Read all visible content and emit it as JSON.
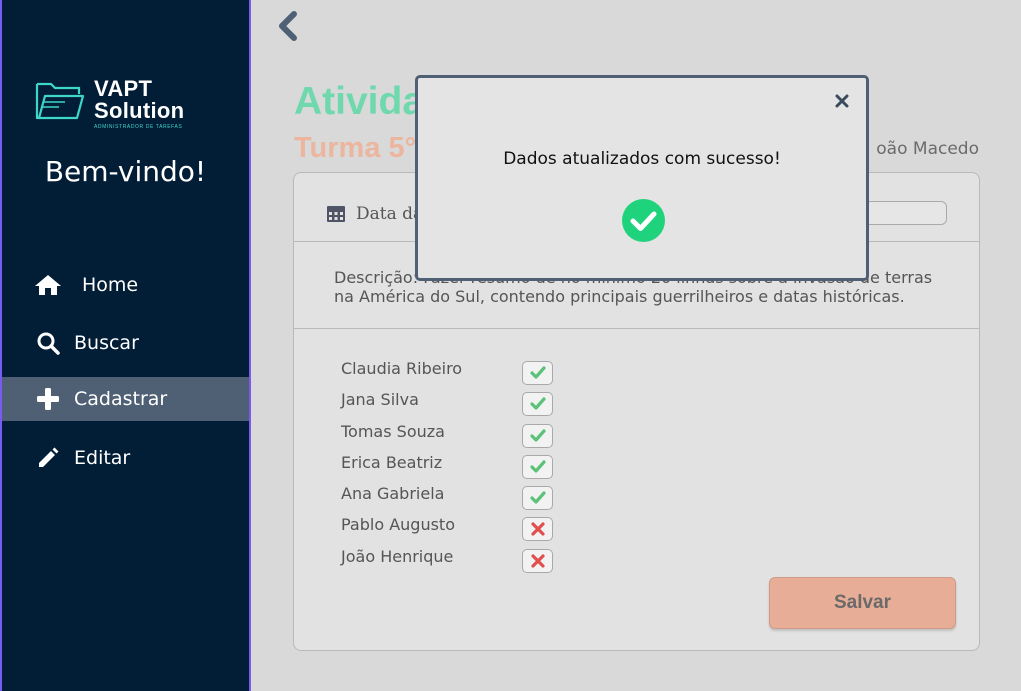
{
  "sidebar": {
    "logo": {
      "line1": "VAPT",
      "line2": "Solution",
      "tagline": "ADMINISTRADOR DE TAREFAS"
    },
    "welcome": "Bem-vindo!",
    "nav": [
      {
        "label": "Home",
        "icon": "home-icon"
      },
      {
        "label": "Buscar",
        "icon": "search-icon"
      },
      {
        "label": "Cadastrar",
        "icon": "plus-icon",
        "active": true
      },
      {
        "label": "Editar",
        "icon": "pencil-icon"
      }
    ]
  },
  "main": {
    "title": "Ativida",
    "subtitle": "Turma 5°",
    "teacher": "oão Macedo",
    "date_label": "Data da",
    "description": "Descrição: Fazer resumo de no mínimo 20 linhas sobre a invasão de terras na América do Sul, contendo principais guerrilheiros e datas históricas.",
    "students": [
      {
        "name": "Claudia Ribeiro",
        "present": true
      },
      {
        "name": "Jana Silva",
        "present": true
      },
      {
        "name": "Tomas Souza",
        "present": true
      },
      {
        "name": "Erica Beatriz",
        "present": true
      },
      {
        "name": "Ana Gabriela",
        "present": true
      },
      {
        "name": "Pablo Augusto",
        "present": false
      },
      {
        "name": "João Henrique",
        "present": false
      }
    ],
    "save_label": "Salvar"
  },
  "modal": {
    "message": "Dados atualizados com sucesso!"
  },
  "colors": {
    "sidebar_bg": "#021d36",
    "active_nav": "#4f5f74",
    "title": "#6fd9ad",
    "subtitle": "#ebb59e",
    "save_button": "#e8ad96",
    "check_green": "#5cc27a",
    "cross_red": "#e0504f",
    "success_green": "#1fd37c"
  }
}
